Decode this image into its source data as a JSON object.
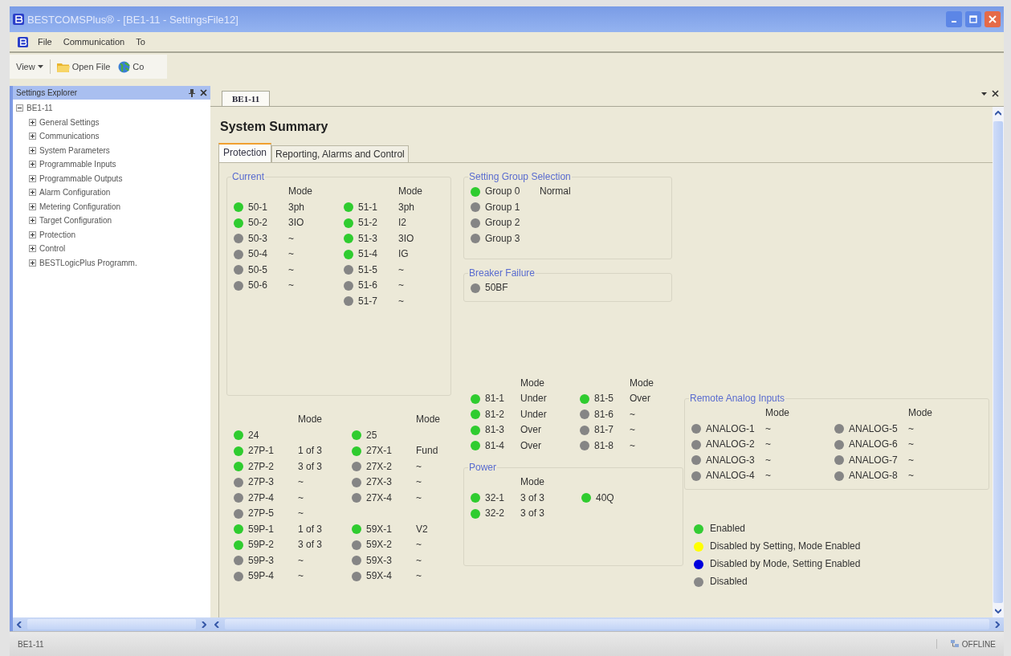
{
  "window": {
    "title": "BESTCOMSPlus® - [BE1-11 - SettingsFile12]"
  },
  "menu": [
    {
      "label": "File"
    },
    {
      "label": "Communication"
    },
    {
      "label": "To"
    }
  ],
  "toolbar": [
    {
      "label": "View",
      "kind": "dropdown"
    },
    {
      "label": "Open File",
      "kind": "folder"
    },
    {
      "label": "Co",
      "kind": "globe"
    }
  ],
  "explorer": {
    "title": "Settings Explorer",
    "tree": [
      {
        "label": "BE1-11",
        "expanded": true,
        "children": [
          {
            "label": "General Settings",
            "expanded": false
          },
          {
            "label": "Communications",
            "expanded": false
          },
          {
            "label": "System Parameters",
            "expanded": false
          },
          {
            "label": "Programmable Inputs",
            "expanded": false
          },
          {
            "label": "Programmable Outputs",
            "expanded": false
          },
          {
            "label": "Alarm Configuration",
            "expanded": false
          },
          {
            "label": "Metering Configuration",
            "expanded": false
          },
          {
            "label": "Target Configuration",
            "expanded": false
          },
          {
            "label": "Protection",
            "expanded": false
          },
          {
            "label": "Control",
            "expanded": false
          },
          {
            "label": "BESTLogicPlus Programm.",
            "expanded": false
          }
        ]
      }
    ]
  },
  "document_tab": {
    "label": "BE1-11"
  },
  "summary": {
    "title": "System Summary",
    "tabs": [
      {
        "label": "Protection",
        "selected": true
      },
      {
        "label": "Reporting, Alarms and Control",
        "selected": false
      }
    ],
    "current": {
      "title": "Current",
      "columns": [
        {
          "header": "Mode",
          "rows": [
            {
              "name": "50-1",
              "mode": "3ph",
              "enabled": true
            },
            {
              "name": "50-2",
              "mode": "3IO",
              "enabled": true
            },
            {
              "name": "50-3",
              "mode": "~",
              "enabled": false
            },
            {
              "name": "50-4",
              "mode": "~",
              "enabled": false
            },
            {
              "name": "50-5",
              "mode": "~",
              "enabled": false
            },
            {
              "name": "50-6",
              "mode": "~",
              "enabled": false
            }
          ]
        },
        {
          "header": "Mode",
          "rows": [
            {
              "name": "51-1",
              "mode": "3ph",
              "enabled": true
            },
            {
              "name": "51-2",
              "mode": "I2",
              "enabled": true
            },
            {
              "name": "51-3",
              "mode": "3IO",
              "enabled": true
            },
            {
              "name": "51-4",
              "mode": "IG",
              "enabled": true
            },
            {
              "name": "51-5",
              "mode": "~",
              "enabled": false
            },
            {
              "name": "51-6",
              "mode": "~",
              "enabled": false
            },
            {
              "name": "51-7",
              "mode": "~",
              "enabled": false
            }
          ]
        }
      ]
    },
    "setting_group": {
      "title": "Setting Group Selection",
      "columns": [
        {
          "rows": [
            {
              "name": "Group 0",
              "mode": "Normal",
              "enabled": true
            },
            {
              "name": "Group 1",
              "enabled": false
            },
            {
              "name": "Group 2",
              "enabled": false
            },
            {
              "name": "Group 3",
              "enabled": false
            }
          ]
        }
      ]
    },
    "breaker_failure": {
      "title": "Breaker Failure",
      "columns": [
        {
          "rows": [
            {
              "name": "50BF",
              "enabled": false
            }
          ]
        }
      ]
    },
    "voltage_27": {
      "columns": [
        {
          "header": "Mode",
          "rows": [
            {
              "name": "24",
              "enabled": true
            },
            {
              "name": "27P-1",
              "mode": "1 of 3",
              "enabled": true
            },
            {
              "name": "27P-2",
              "mode": "3 of 3",
              "enabled": true
            },
            {
              "name": "27P-3",
              "mode": "~",
              "enabled": false
            },
            {
              "name": "27P-4",
              "mode": "~",
              "enabled": false
            },
            {
              "name": "27P-5",
              "mode": "~",
              "enabled": false
            }
          ]
        },
        {
          "header": "Mode",
          "rows": [
            {
              "name": "25",
              "enabled": true
            },
            {
              "name": "27X-1",
              "mode": "Fund",
              "enabled": true
            },
            {
              "name": "27X-2",
              "mode": "~",
              "enabled": false
            },
            {
              "name": "27X-3",
              "mode": "~",
              "enabled": false
            },
            {
              "name": "27X-4",
              "mode": "~",
              "enabled": false
            }
          ]
        }
      ]
    },
    "voltage_59": {
      "columns": [
        {
          "rows": [
            {
              "name": "59P-1",
              "mode": "1 of 3",
              "enabled": true
            },
            {
              "name": "59P-2",
              "mode": "3 of 3",
              "enabled": true
            },
            {
              "name": "59P-3",
              "mode": "~",
              "enabled": false
            },
            {
              "name": "59P-4",
              "mode": "~",
              "enabled": false
            }
          ]
        },
        {
          "rows": [
            {
              "name": "59X-1",
              "mode": "V2",
              "enabled": true
            },
            {
              "name": "59X-2",
              "mode": "~",
              "enabled": false
            },
            {
              "name": "59X-3",
              "mode": "~",
              "enabled": false
            },
            {
              "name": "59X-4",
              "mode": "~",
              "enabled": false
            }
          ]
        }
      ]
    },
    "frequency": {
      "columns": [
        {
          "header": "Mode",
          "rows": [
            {
              "name": "81-1",
              "mode": "Under",
              "enabled": true
            },
            {
              "name": "81-2",
              "mode": "Under",
              "enabled": true
            },
            {
              "name": "81-3",
              "mode": "Over",
              "enabled": true
            },
            {
              "name": "81-4",
              "mode": "Over",
              "enabled": true
            }
          ]
        },
        {
          "header": "Mode",
          "rows": [
            {
              "name": "81-5",
              "mode": "Over",
              "enabled": true
            },
            {
              "name": "81-6",
              "mode": "~",
              "enabled": false
            },
            {
              "name": "81-7",
              "mode": "~",
              "enabled": false
            },
            {
              "name": "81-8",
              "mode": "~",
              "enabled": false
            }
          ]
        }
      ]
    },
    "power": {
      "title": "Power",
      "columns": [
        {
          "header": "Mode",
          "rows": [
            {
              "name": "32-1",
              "mode": "3 of 3",
              "enabled": true
            },
            {
              "name": "32-2",
              "mode": "3 of 3",
              "enabled": true
            }
          ]
        },
        {
          "rows": [
            {
              "name": "40Q",
              "enabled": true
            }
          ]
        }
      ]
    },
    "remote_analog": {
      "title": "Remote Analog Inputs",
      "columns": [
        {
          "header": "Mode",
          "rows": [
            {
              "name": "ANALOG-1",
              "mode": "~",
              "enabled": false
            },
            {
              "name": "ANALOG-2",
              "mode": "~",
              "enabled": false
            },
            {
              "name": "ANALOG-3",
              "mode": "~",
              "enabled": false
            },
            {
              "name": "ANALOG-4",
              "mode": "~",
              "enabled": false
            }
          ]
        },
        {
          "header": "Mode",
          "rows": [
            {
              "name": "ANALOG-5",
              "mode": "~",
              "enabled": false
            },
            {
              "name": "ANALOG-6",
              "mode": "~",
              "enabled": false
            },
            {
              "name": "ANALOG-7",
              "mode": "~",
              "enabled": false
            },
            {
              "name": "ANALOG-8",
              "mode": "~",
              "enabled": false
            }
          ]
        }
      ]
    },
    "legend": [
      {
        "label": "Enabled",
        "color": "#33cc33"
      },
      {
        "label": "Disabled by Setting, Mode Enabled",
        "color": "#ffff00"
      },
      {
        "label": "Disabled by Mode, Setting Enabled",
        "color": "#0000dd"
      },
      {
        "label": "Disabled",
        "color": "#888888"
      }
    ]
  },
  "status_bar": {
    "left": "BE1-11",
    "right": "OFFLINE"
  }
}
